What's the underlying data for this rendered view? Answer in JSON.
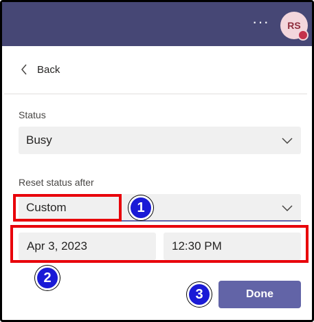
{
  "header": {
    "more_label": "···",
    "avatar_initials": "RS",
    "bar_color": "#464775"
  },
  "nav": {
    "back_label": "Back"
  },
  "status": {
    "label": "Status",
    "value": "Busy"
  },
  "reset": {
    "label": "Reset status after",
    "value": "Custom",
    "date": "Apr 3, 2023",
    "time": "12:30 PM"
  },
  "actions": {
    "done_label": "Done"
  },
  "annotations": {
    "step1": "1",
    "step2": "2",
    "step3": "3",
    "highlight_color": "#e8000a",
    "badge_color": "#1a1ad6"
  },
  "icons": {
    "back": "chevron-left-icon",
    "dropdown": "chevron-down-icon",
    "more": "more-options-icon"
  }
}
